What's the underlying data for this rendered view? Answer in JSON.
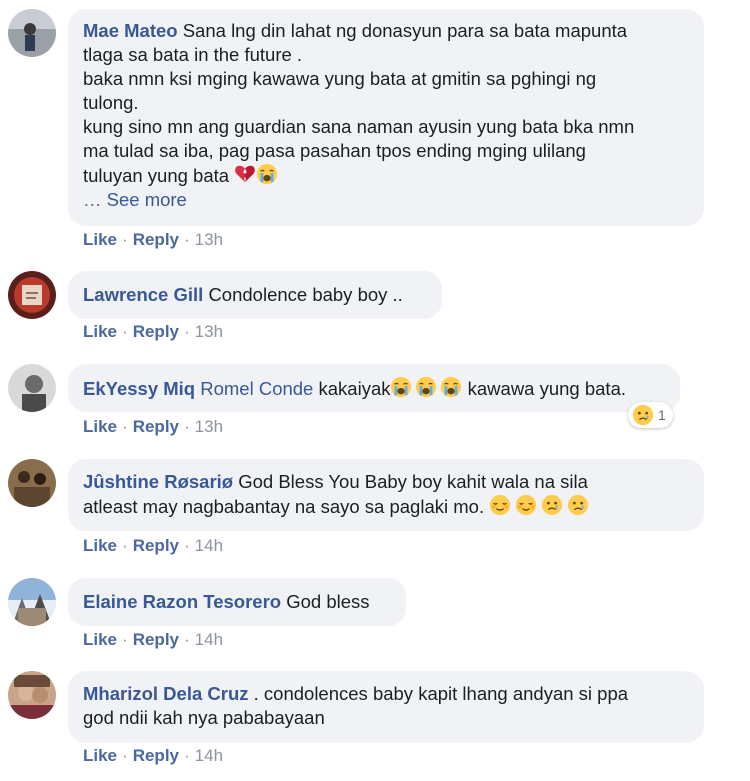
{
  "comments": [
    {
      "author": "Mae Mateo",
      "lines": [
        "Sana lng din lahat ng donasyun para sa bata mapunta",
        "tlaga sa bata in the future .",
        "baka nmn ksi mging kawawa yung bata at gmitin sa pghingi ng",
        "tulong.",
        "kung sino mn ang guardian sana naman ayusin yung bata bka nmn",
        "ma tulad sa iba, pag pasa pasahan tpos ending mging ulilang",
        "tuluyan yung bata"
      ],
      "ellipsis": "…",
      "see_more": "See more",
      "emojis": [
        "broken-heart-icon",
        "crying-face-icon"
      ],
      "like": "Like",
      "reply": "Reply",
      "time": "13h"
    },
    {
      "author": "Lawrence Gill",
      "text": "Condolence baby boy ..",
      "like": "Like",
      "reply": "Reply",
      "time": "13h"
    },
    {
      "author": "EkYessy Miq",
      "mention": "Romel Conde",
      "text_before": "kakaiyak",
      "text_after": "kawawa yung bata.",
      "emojis": [
        "crying-face-icon",
        "crying-face-icon",
        "crying-face-icon"
      ],
      "reaction_icon": "sad-face-icon",
      "reaction_count": "1",
      "like": "Like",
      "reply": "Reply",
      "time": "13h"
    },
    {
      "author": "Jûshtine Røsariø",
      "line1": "God Bless You Baby boy kahit wala na sila",
      "line2": "atleast may nagbabantay na sayo sa paglaki mo.",
      "emojis": [
        "relieved-face-icon",
        "relieved-face-icon",
        "sad-face-icon",
        "sad-face-icon"
      ],
      "like": "Like",
      "reply": "Reply",
      "time": "14h"
    },
    {
      "author": "Elaine Razon Tesorero",
      "text": "God bless",
      "like": "Like",
      "reply": "Reply",
      "time": "14h"
    },
    {
      "author": "Mharizol Dela Cruz",
      "line1": ". condolences baby kapit lhang andyan si ppa",
      "line2": "god ndii kah nya pababayaan",
      "like": "Like",
      "reply": "Reply",
      "time": "14h"
    }
  ],
  "colors": {
    "bubble": "#f0f2f5",
    "author": "#385898",
    "meta": "#8d949e"
  }
}
